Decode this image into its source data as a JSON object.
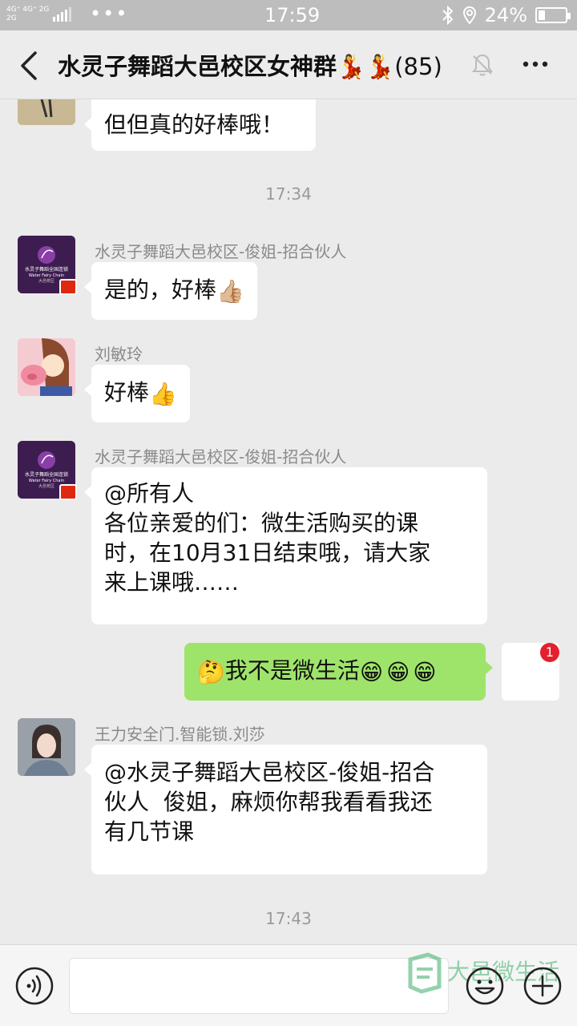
{
  "status_bar": {
    "network": "4G⁺ 4G⁺ 2G",
    "network_line2": "2G",
    "dots": "•••",
    "time": "17:59",
    "battery": "24%",
    "battery_level": 0.24,
    "icons": [
      "bluetooth-icon",
      "location-icon",
      "battery-icon"
    ]
  },
  "header": {
    "title": "水灵子舞蹈大邑校区女神群",
    "emoji": "💃💃",
    "member_count": "(85)",
    "icons": [
      "back-icon",
      "mute-bell-icon",
      "more-icon"
    ]
  },
  "messages": [
    {
      "type": "incoming",
      "sender": "",
      "text": "但但真的好棒哦！"
    },
    {
      "type": "time",
      "text": "17:34"
    },
    {
      "type": "incoming",
      "sender": "水灵子舞蹈大邑校区-俊姐-招合伙人",
      "text": "是的，好棒",
      "emoji": "👍🏼"
    },
    {
      "type": "incoming",
      "sender": "刘敏玲",
      "text": "好棒",
      "emoji": "👍"
    },
    {
      "type": "incoming",
      "sender": "水灵子舞蹈大邑校区-俊姐-招合伙人",
      "lines": [
        "@所有人",
        "各位亲爱的们：微生活购买的课",
        "时，在10月31日结束哦，请大家",
        "来上课哦……"
      ]
    },
    {
      "type": "outgoing",
      "text": "我不是微生活",
      "emoji_before": "🤔",
      "emoji_after": "😁😁😁",
      "badge": "1"
    },
    {
      "type": "incoming",
      "sender": "王力安全门.智能锁.刘莎",
      "lines": [
        "@水灵子舞蹈大邑校区-俊姐-招合",
        "伙人  俊姐，麻烦你帮我看看我还",
        "有几节课"
      ]
    },
    {
      "type": "time",
      "text": "17:43"
    }
  ],
  "avatar_text": {
    "logo_line1": "水灵子舞蹈全国连锁",
    "logo_line2": "Water Fairy Chain",
    "logo_line3": "大邑校区"
  },
  "input_bar": {
    "watermark": "大邑微生活",
    "icons": [
      "voice-icon",
      "emoji-icon",
      "plus-icon"
    ]
  },
  "colors": {
    "outgoing_bubble": "#9fe46a",
    "incoming_bubble": "#ffffff",
    "background": "#ebebeb",
    "badge": "#e5202e"
  }
}
